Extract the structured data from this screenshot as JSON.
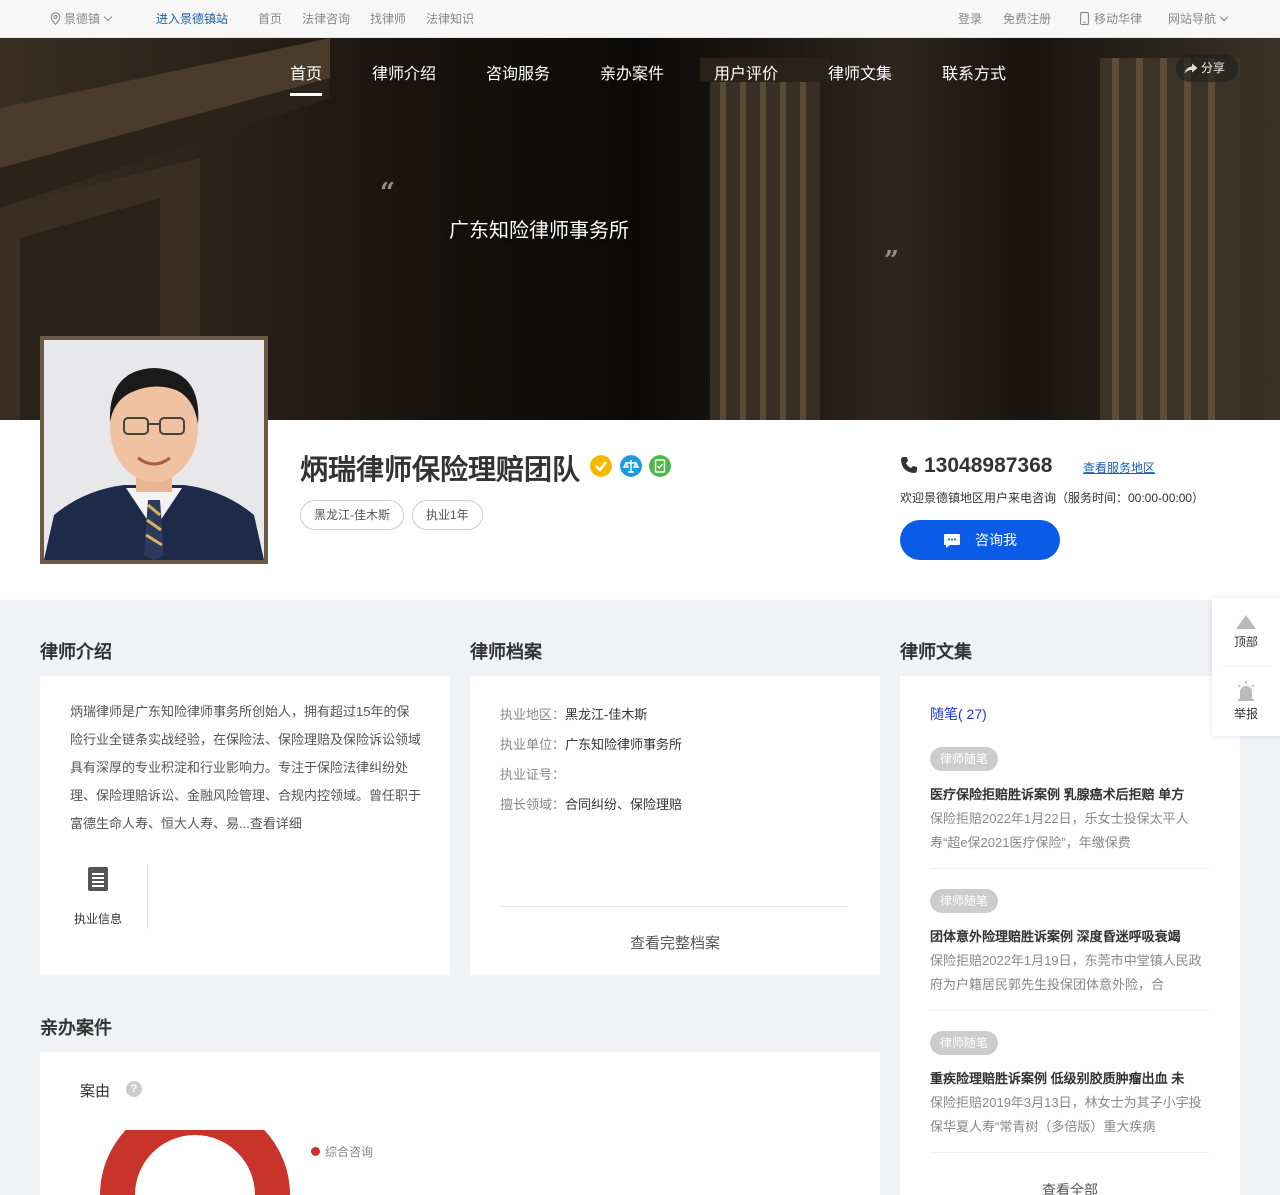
{
  "topbar": {
    "location": "景德镇",
    "enter_site": "进入景德镇站",
    "links": [
      "首页",
      "法律咨询",
      "找律师",
      "法律知识"
    ],
    "login": "登录",
    "register": "免费注册",
    "mobile": "移动华律",
    "site_nav": "网站导航"
  },
  "nav": {
    "items": [
      "首页",
      "律师介绍",
      "咨询服务",
      "亲办案件",
      "用户评价",
      "律师文集",
      "联系方式"
    ],
    "active": "首页",
    "share": "分享"
  },
  "hero": {
    "firm_name": "广东知险律师事务所"
  },
  "profile": {
    "name": "炳瑞律师保险理赔团队",
    "tags": [
      "黑龙江-佳木斯",
      "执业1年"
    ],
    "phone": "13048987368",
    "service_area_link": "查看服务地区",
    "welcome": "欢迎景德镇地区用户来电咨询（服务时间：00:00-00:00）",
    "consult_button": "咨询我"
  },
  "intro": {
    "title": "律师介绍",
    "text": "炳瑞律师是广东知险律师事务所创始人，拥有超过15年的保险行业全链条实战经验，在保险法、保险理赔及保险诉讼领域具有深厚的专业积淀和行业影响力。专注于保险法律纠纷处理、保险理赔诉讼、金融风险管理、合规内控领域。曾任职于富德生命人寿、恒大人寿、易...查看详细",
    "info_label": "执业信息"
  },
  "archive": {
    "title": "律师档案",
    "rows": [
      {
        "k": "执业地区：",
        "v": "黑龙江-佳木斯"
      },
      {
        "k": "执业单位：",
        "v": "广东知险律师事务所"
      },
      {
        "k": "执业证号：",
        "v": ""
      },
      {
        "k": "擅长领域：",
        "v": "合同纠纷、保险理赔"
      }
    ],
    "more": "查看完整档案"
  },
  "essays": {
    "title": "律师文集",
    "category": "随笔( 27)",
    "items": [
      {
        "tag": "律师随笔",
        "title": "医疗保险拒赔胜诉案例 乳腺癌术后拒赔 单方",
        "desc": "保险拒赔2022年1月22日，乐女士投保太平人寿“超e保2021医疗保险”，年缴保费"
      },
      {
        "tag": "律师随笔",
        "title": "团体意外险理赔胜诉案例 深度昏迷呼吸衰竭",
        "desc": "保险拒赔2022年1月19日，东莞市中堂镇人民政府为户籍居民郭先生投保团体意外险，合"
      },
      {
        "tag": "律师随笔",
        "title": "重疾险理赔胜诉案例 低级别胶质肿瘤出血 未",
        "desc": "保险拒赔2019年3月13日，林女士为其子小宇投保华夏人寿“常青树（多倍版）重大疾病"
      }
    ],
    "more": "查看全部"
  },
  "cases": {
    "title": "亲办案件",
    "label": "案由",
    "help": "?",
    "legend": "综合咨询",
    "color": "#c8342a"
  },
  "floatbar": {
    "top": "顶部",
    "report": "举报"
  }
}
